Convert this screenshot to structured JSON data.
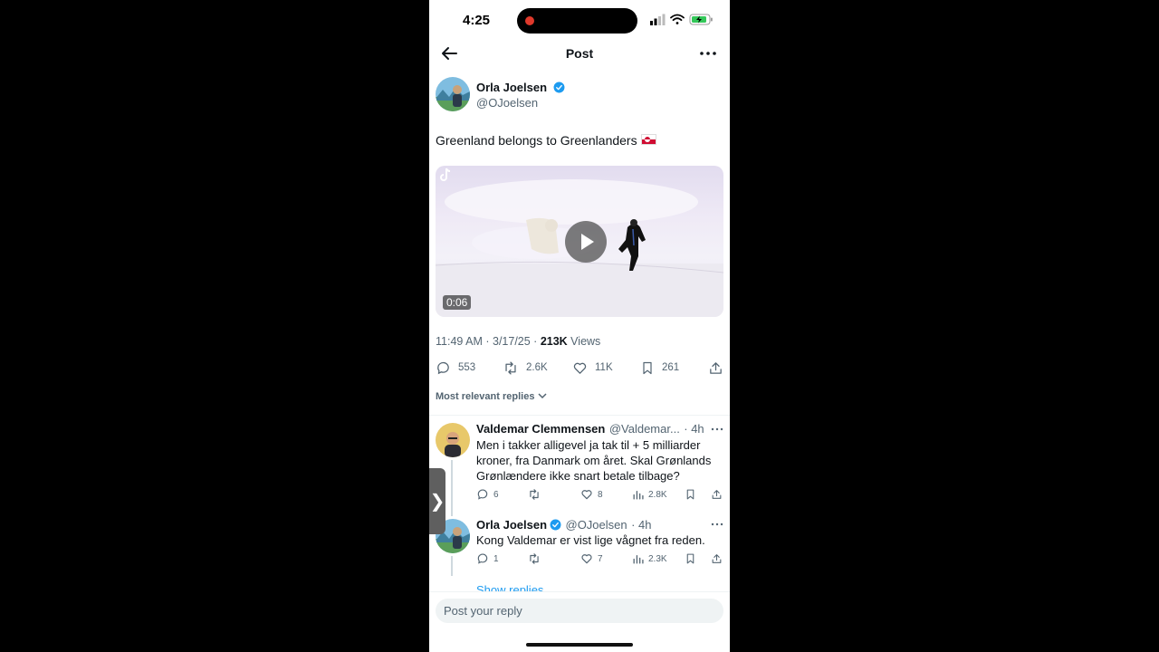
{
  "status_bar": {
    "time": "4:25"
  },
  "header": {
    "title": "Post"
  },
  "post": {
    "author_name": "Orla Joelsen",
    "author_handle": "@OJoelsen",
    "text": "Greenland belongs to Greenlanders",
    "video": {
      "duration": "0:06"
    },
    "timestamp": "11:49 AM · 3/17/25 · ",
    "views_count": "213K",
    "views_label": " Views",
    "actions": {
      "replies": "553",
      "reposts": "2.6K",
      "likes": "11K",
      "bookmarks": "261"
    }
  },
  "sort": {
    "label": "Most relevant replies"
  },
  "replies": [
    {
      "name": "Valdemar Clemmensen",
      "handle": "@Valdemar...",
      "time": "· 4h",
      "text": "Men i takker alligevel ja tak til + 5 milliarder kroner, fra Danmark om året. Skal Grønlands Grønlændere ikke snart betale tilbage?",
      "replies": "6",
      "likes": "8",
      "views": "2.8K"
    },
    {
      "name": "Orla Joelsen",
      "handle": "@OJoelsen",
      "time": "· 4h",
      "text": "Kong Valdemar er vist lige vågnet fra reden.",
      "replies": "1",
      "likes": "7",
      "views": "2.3K"
    }
  ],
  "show_replies": "Show replies",
  "reply_box": {
    "placeholder": "Post your reply"
  },
  "side_tab": {
    "glyph": "❯"
  },
  "icons": [
    "back-arrow-icon",
    "more-icon",
    "verified-icon",
    "reply-icon",
    "repost-icon",
    "like-icon",
    "bookmark-icon",
    "share-icon",
    "views-icon",
    "play-icon",
    "tiktok-icon",
    "chevron-down-icon",
    "signal-icon",
    "wifi-icon",
    "battery-icon"
  ],
  "colors": {
    "accent": "#1d9bf0",
    "text": "#0f1419",
    "muted": "#536471",
    "battery": "#34c759"
  }
}
